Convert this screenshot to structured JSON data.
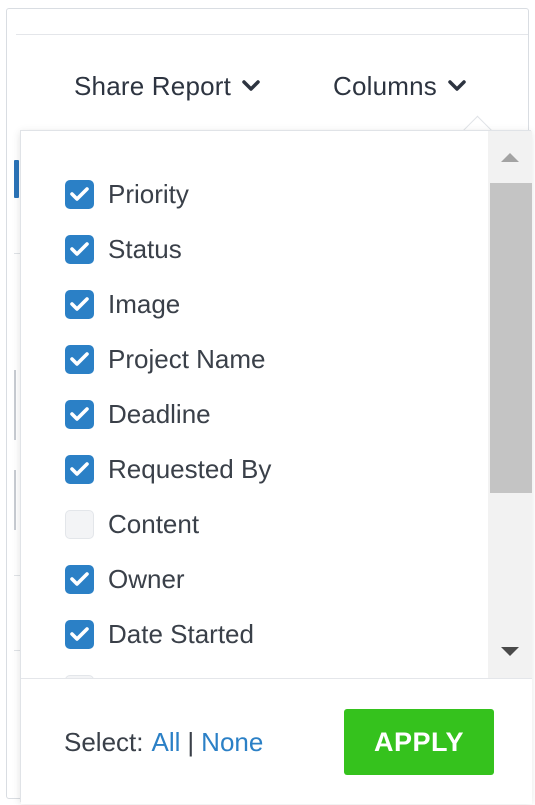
{
  "toolbar": {
    "share_report_label": "Share Report",
    "columns_label": "Columns"
  },
  "columns_menu": {
    "items": [
      {
        "label": "Priority",
        "checked": true
      },
      {
        "label": "Status",
        "checked": true
      },
      {
        "label": "Image",
        "checked": true
      },
      {
        "label": "Project Name",
        "checked": true
      },
      {
        "label": "Deadline",
        "checked": true
      },
      {
        "label": "Requested By",
        "checked": true
      },
      {
        "label": "Content",
        "checked": false
      },
      {
        "label": "Owner",
        "checked": true
      },
      {
        "label": "Date Started",
        "checked": true
      }
    ],
    "select_label": "Select:",
    "select_all": "All",
    "select_separator": "|",
    "select_none": "None",
    "apply_label": "APPLY"
  },
  "colors": {
    "accent_blue": "#2b80c6",
    "apply_green": "#35c21d",
    "text": "#3a4049"
  }
}
